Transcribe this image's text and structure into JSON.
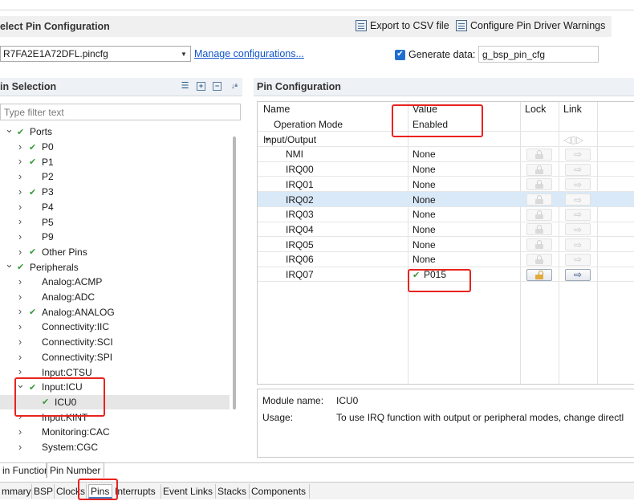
{
  "header": {
    "title": "elect Pin Configuration",
    "export_label": "Export to CSV file",
    "export_icon": "export-csv-icon",
    "warnings_label": "Configure Pin Driver Warnings",
    "warnings_icon": "pin-driver-warnings-icon"
  },
  "config": {
    "file_value": "R7FA2E1A72DFL.pincfg",
    "manage_link": "Manage configurations...",
    "generate_label": "Generate data:",
    "generate_checked": true,
    "generate_value": "g_bsp_pin_cfg"
  },
  "pin_selection": {
    "title": "in Selection",
    "toolbar_icons": [
      "show-list-icon",
      "expand-all-icon",
      "collapse-all-icon",
      "sort-az-icon"
    ],
    "filter_placeholder": "Type filter text",
    "tree": [
      {
        "label": "Ports",
        "level": 0,
        "expanded": true,
        "checked": true
      },
      {
        "label": "P0",
        "level": 1,
        "expandable": true,
        "checked": true
      },
      {
        "label": "P1",
        "level": 1,
        "expandable": true,
        "checked": true
      },
      {
        "label": "P2",
        "level": 1,
        "expandable": true,
        "checked": false
      },
      {
        "label": "P3",
        "level": 1,
        "expandable": true,
        "checked": true
      },
      {
        "label": "P4",
        "level": 1,
        "expandable": true,
        "checked": false
      },
      {
        "label": "P5",
        "level": 1,
        "expandable": true,
        "checked": false
      },
      {
        "label": "P9",
        "level": 1,
        "expandable": true,
        "checked": false
      },
      {
        "label": "Other Pins",
        "level": 1,
        "expandable": true,
        "checked": true
      },
      {
        "label": "Peripherals",
        "level": 0,
        "expanded": true,
        "checked": true
      },
      {
        "label": "Analog:ACMP",
        "level": 1,
        "expandable": true,
        "checked": false
      },
      {
        "label": "Analog:ADC",
        "level": 1,
        "expandable": true,
        "checked": false
      },
      {
        "label": "Analog:ANALOG",
        "level": 1,
        "expandable": true,
        "checked": true
      },
      {
        "label": "Connectivity:IIC",
        "level": 1,
        "expandable": true,
        "checked": false
      },
      {
        "label": "Connectivity:SCI",
        "level": 1,
        "expandable": true,
        "checked": false
      },
      {
        "label": "Connectivity:SPI",
        "level": 1,
        "expandable": true,
        "checked": false
      },
      {
        "label": "Input:CTSU",
        "level": 1,
        "expandable": true,
        "checked": false
      },
      {
        "label": "Input:ICU",
        "level": 1,
        "expanded": true,
        "checked": true
      },
      {
        "label": "ICU0",
        "level": 2,
        "checked": true,
        "selected": true
      },
      {
        "label": "Input:KINT",
        "level": 1,
        "expandable": true,
        "checked": false
      },
      {
        "label": "Monitoring:CAC",
        "level": 1,
        "expandable": true,
        "checked": false
      },
      {
        "label": "System:CGC",
        "level": 1,
        "expandable": true,
        "checked": false
      }
    ]
  },
  "pin_config": {
    "title": "Pin Configuration",
    "columns": {
      "name": "Name",
      "value": "Value",
      "lock": "Lock",
      "link": "Link"
    },
    "rows": [
      {
        "name": "Operation Mode",
        "value": "Enabled",
        "indent": 1
      },
      {
        "name": "Input/Output",
        "value": "",
        "indent": 0,
        "group": true
      },
      {
        "name": "NMI",
        "value": "None",
        "indent": 2
      },
      {
        "name": "IRQ00",
        "value": "None",
        "indent": 2
      },
      {
        "name": "IRQ01",
        "value": "None",
        "indent": 2
      },
      {
        "name": "IRQ02",
        "value": "None",
        "indent": 2,
        "highlighted": true
      },
      {
        "name": "IRQ03",
        "value": "None",
        "indent": 2
      },
      {
        "name": "IRQ04",
        "value": "None",
        "indent": 2
      },
      {
        "name": "IRQ05",
        "value": "None",
        "indent": 2
      },
      {
        "name": "IRQ06",
        "value": "None",
        "indent": 2
      },
      {
        "name": "IRQ07",
        "value": "P015",
        "indent": 2,
        "checked": true,
        "active": true
      }
    ]
  },
  "info": {
    "module_label": "Module name:",
    "module_value": "ICU0",
    "usage_label": "Usage:",
    "usage_value": "To use IRQ function with output or peripheral modes, change directl"
  },
  "inner_tabs": [
    {
      "label": "in Function",
      "active": false
    },
    {
      "label": "Pin Number",
      "active": true
    }
  ],
  "outer_tabs": [
    {
      "label": "mmary",
      "active": false
    },
    {
      "label": "BSP",
      "active": false
    },
    {
      "label": "Clocks",
      "active": false
    },
    {
      "label": "Pins",
      "active": true
    },
    {
      "label": "Interrupts",
      "active": false
    },
    {
      "label": "Event Links",
      "active": false
    },
    {
      "label": "Stacks",
      "active": false
    },
    {
      "label": "Components",
      "active": false
    }
  ],
  "colors": {
    "annotation_red": "#e8231f",
    "check_green": "#3a9a3a",
    "selection_blue": "#d9e9f8",
    "link_blue": "#1155cc"
  }
}
